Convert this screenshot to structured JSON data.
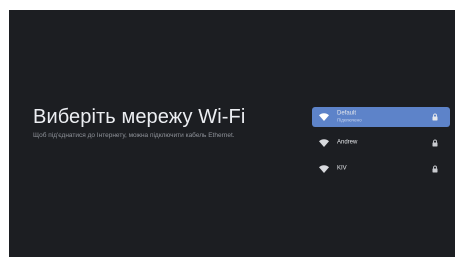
{
  "page": {
    "title": "Виберіть мережу Wi-Fi",
    "subtitle": "Щоб під'єднатися до Інтернету, можна підключити кабель Ethernet."
  },
  "networks": [
    {
      "name": "Default",
      "status": "Підключено",
      "selected": true,
      "secured": true,
      "icon": "wifi-icon"
    },
    {
      "name": "Andrew",
      "status": "",
      "selected": false,
      "secured": true,
      "icon": "wifi-icon"
    },
    {
      "name": "KIV",
      "status": "",
      "selected": false,
      "secured": true,
      "icon": "wifi-icon"
    }
  ],
  "colors": {
    "background": "#1c1e22",
    "selected": "#5d83c9",
    "title": "#eceef2",
    "subtitle": "#8f939a"
  }
}
